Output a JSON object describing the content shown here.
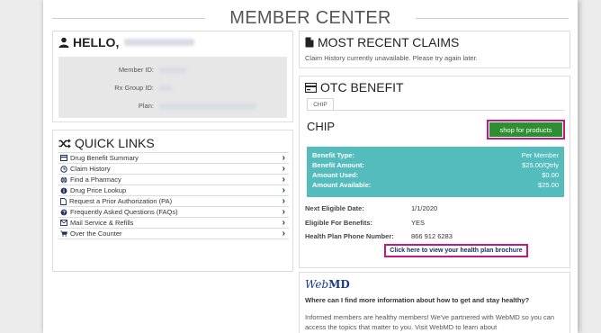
{
  "page_title": "MEMBER CENTER",
  "hello": {
    "greeting": "HELLO,",
    "labels": {
      "member_id": "Member ID:",
      "rx_group_id": "Rx Group ID:",
      "plan": "Plan:"
    }
  },
  "quick_links": {
    "title": "QUICK LINKS",
    "items": [
      {
        "label": "Drug Benefit Summary",
        "icon": "card-icon"
      },
      {
        "label": "Claim History",
        "icon": "clock-icon"
      },
      {
        "label": "Find a Pharmacy",
        "icon": "globe-icon"
      },
      {
        "label": "Drug Price Lookup",
        "icon": "info-icon"
      },
      {
        "label": "Request a Prior Authorization (PA)",
        "icon": "document-icon"
      },
      {
        "label": "Frequently Asked Questions (FAQs)",
        "icon": "question-icon"
      },
      {
        "label": "Mail Service & Refills",
        "icon": "envelope-icon"
      },
      {
        "label": "Over the Counter",
        "icon": "cart-icon"
      }
    ],
    "chevron": "›"
  },
  "claims": {
    "title": "MOST RECENT CLAIMS",
    "message": "Claim History currently unavailable. Please try again later."
  },
  "otc": {
    "title": "OTC BENEFIT",
    "tab_label": "CHIP",
    "plan_title": "CHIP",
    "shop_button": "shop for products",
    "benefit": [
      {
        "key": "Benefit Type:",
        "value": "Per Member"
      },
      {
        "key": "Benefit Amount:",
        "value": "$25.00/Qtrly"
      },
      {
        "key": "Amount Used:",
        "value": "$0.00"
      },
      {
        "key": "Amount Available:",
        "value": "$25.00"
      }
    ],
    "details": [
      {
        "key": "Next Eligible Date:",
        "value": "1/1/2020"
      },
      {
        "key": "Eligible For Benefits:",
        "value": "YES"
      },
      {
        "key": "Health Plan Phone Number:",
        "value": "866 912 6283"
      }
    ],
    "brochure_link": "Click here to view your health plan brochure"
  },
  "webmd": {
    "logo_web": "Web",
    "logo_md": "MD",
    "question": "Where can I find more information about how to get and stay healthy?",
    "text": "Informed members are healthy members! We've partnered with WebMD so you can access the topics that matter to you. Visit WebMD to learn about"
  },
  "colors": {
    "accent_green": "#2e8f32",
    "teal": "#54bcbd",
    "highlight_magenta": "#c4177f",
    "navy": "#1c2c5e"
  }
}
